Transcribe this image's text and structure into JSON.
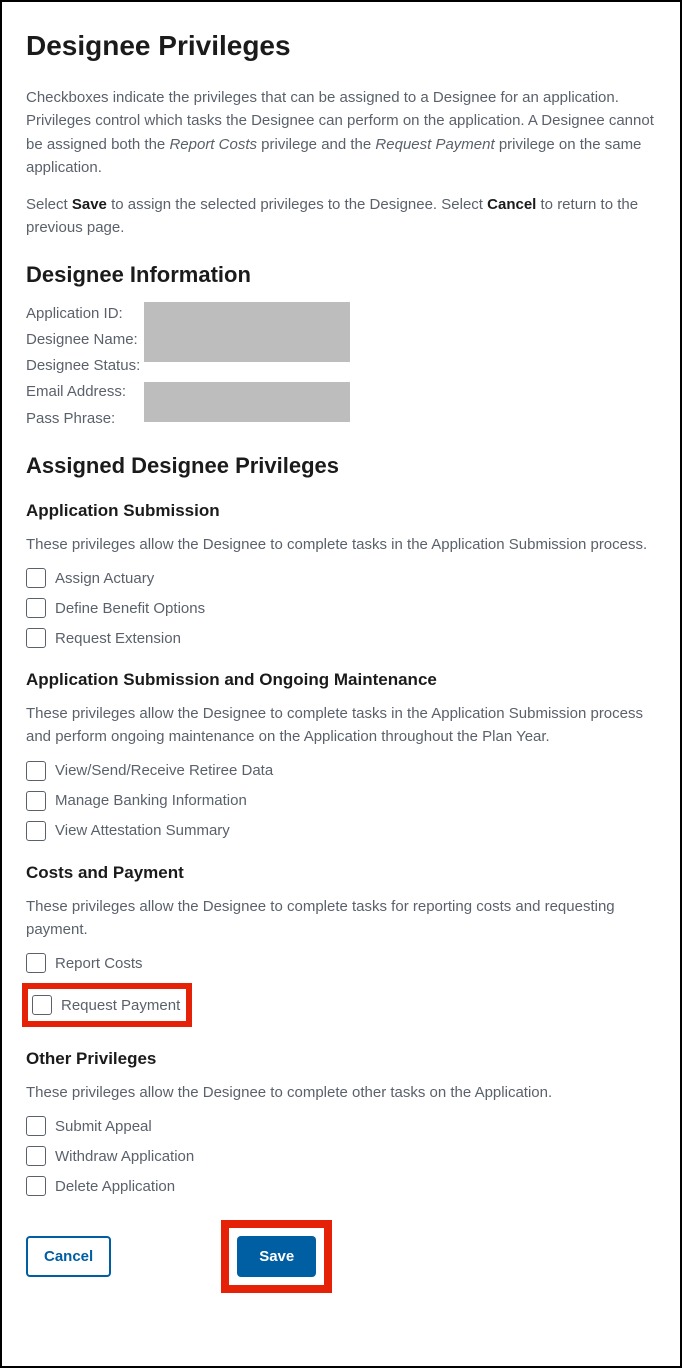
{
  "page_title": "Designee Privileges",
  "intro_paragraph1_parts": {
    "p1": "Checkboxes indicate the privileges that can be assigned to a Designee for an application. Privileges control which tasks the Designee can perform on the application. A Designee cannot be assigned both the ",
    "italic1": "Report Costs",
    "p2": " privilege and the ",
    "italic2": "Request Payment",
    "p3": " privilege on the same application."
  },
  "intro_paragraph2_parts": {
    "p1": "Select ",
    "bold1": "Save",
    "p2": " to assign the selected privileges to the Designee. Select ",
    "bold2": "Cancel",
    "p3": " to return to the previous page."
  },
  "designee_info_heading": "Designee Information",
  "info_labels": {
    "app_id": "Application ID:",
    "designee_name": "Designee Name:",
    "designee_status": "Designee Status:",
    "email": "Email Address:",
    "pass_phrase": "Pass Phrase:"
  },
  "assigned_heading": "Assigned Designee Privileges",
  "sections": {
    "app_submission": {
      "title": "Application Submission",
      "desc": "These privileges allow the Designee to complete tasks in the Application Submission process.",
      "items": [
        "Assign Actuary",
        "Define Benefit Options",
        "Request Extension"
      ]
    },
    "app_submission_ongoing": {
      "title": "Application Submission and Ongoing Maintenance",
      "desc": "These privileges allow the Designee to complete tasks in the Application Submission process and perform ongoing maintenance on the Application throughout the Plan Year.",
      "items": [
        "View/Send/Receive Retiree Data",
        "Manage Banking Information",
        "View Attestation Summary"
      ]
    },
    "costs_payment": {
      "title": "Costs and Payment",
      "desc": "These privileges allow the Designee to complete tasks for reporting costs and requesting payment.",
      "items": [
        "Report Costs",
        "Request Payment"
      ]
    },
    "other": {
      "title": "Other Privileges",
      "desc": "These privileges allow the Designee to complete other tasks on the Application.",
      "items": [
        "Submit Appeal",
        "Withdraw Application",
        "Delete Application"
      ]
    }
  },
  "buttons": {
    "cancel": "Cancel",
    "save": "Save"
  }
}
